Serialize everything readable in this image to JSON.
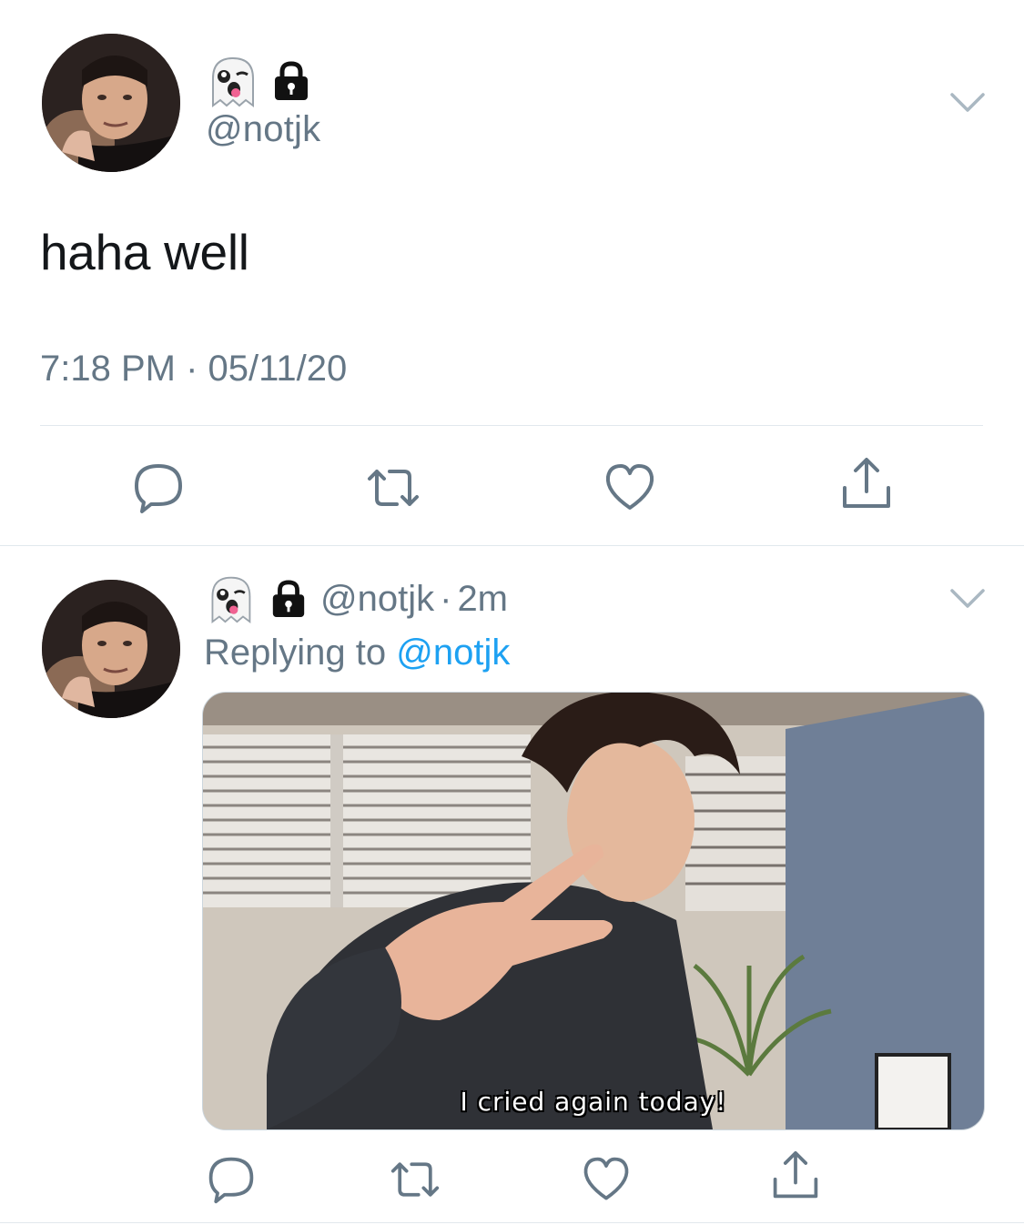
{
  "tweet": {
    "emoji": [
      "ghost",
      "lock"
    ],
    "handle": "@notjk",
    "text": "haha well",
    "timestamp": "7:18 PM · 05/11/20",
    "actions": [
      "reply-icon",
      "retweet-icon",
      "like-icon",
      "share-icon"
    ]
  },
  "reply": {
    "emoji": [
      "ghost",
      "lock"
    ],
    "handle": "@notjk",
    "separator": "·",
    "age": "2m",
    "replying_prefix": "Replying to",
    "replying_to": "@notjk",
    "media_caption": "I cried again today!",
    "actions": [
      "reply-icon",
      "retweet-icon",
      "like-icon",
      "share-icon"
    ]
  },
  "colors": {
    "secondary_text": "#657786",
    "link": "#1da1f2",
    "divider": "#e1e8ed",
    "icon": "#657786"
  }
}
